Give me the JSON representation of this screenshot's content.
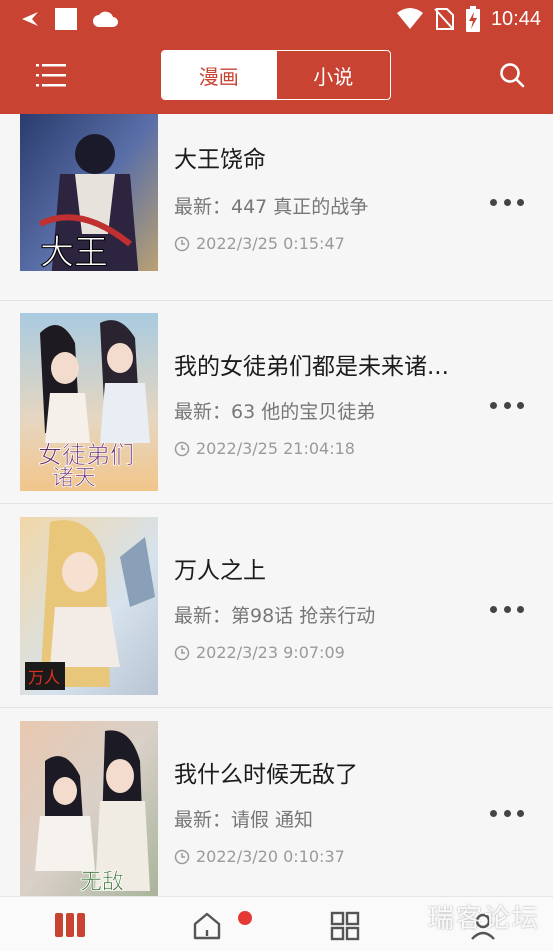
{
  "status_bar": {
    "time": "10:44",
    "icons": [
      "bird-icon",
      "square-icon",
      "cloud-icon",
      "wifi-icon",
      "no-sim-icon",
      "battery-charging-icon"
    ]
  },
  "header": {
    "tabs": [
      {
        "label": "漫画",
        "active": true
      },
      {
        "label": "小说",
        "active": false
      }
    ],
    "menu_icon": "menu-icon",
    "search_icon": "search-icon"
  },
  "list": [
    {
      "title": "大王饶命",
      "latest": "最新：447 真正的战争",
      "time": "2022/3/25 0:15:47"
    },
    {
      "title": "我的女徒弟们都是未来诸...",
      "latest": "最新：63 他的宝贝徒弟",
      "time": "2022/3/25 21:04:18"
    },
    {
      "title": "万人之上",
      "latest": "最新：第98话 抢亲行动",
      "time": "2022/3/23 9:07:09"
    },
    {
      "title": "我什么时候无敌了",
      "latest": "最新：请假 通知",
      "time": "2022/3/20 0:10:37"
    }
  ],
  "bottom_nav": {
    "items": [
      "bookshelf-icon",
      "home-icon",
      "grid-icon",
      "profile-icon"
    ],
    "home_has_notification": true
  },
  "watermark": "瑞客论坛",
  "colors": {
    "primary": "#c84332",
    "badge": "#e53935"
  }
}
